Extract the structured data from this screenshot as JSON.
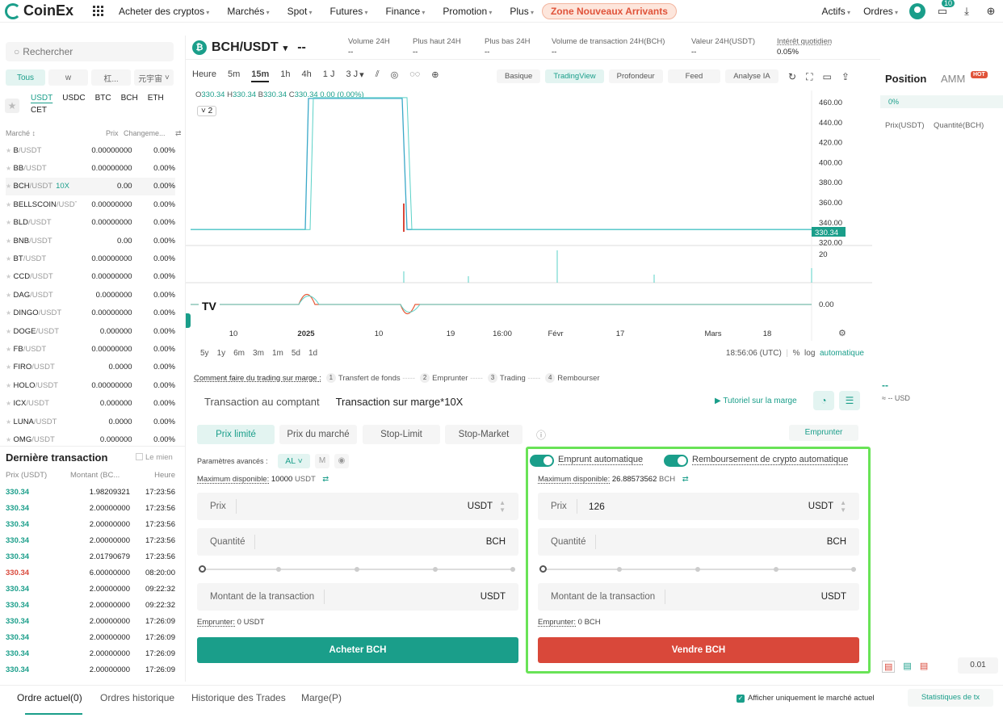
{
  "nav": {
    "logo": "CoinEx",
    "items": [
      "Acheter des cryptos",
      "Marchés",
      "Spot",
      "Futures",
      "Finance",
      "Promotion",
      "Plus"
    ],
    "zone": "Zone Nouveaux Arrivants",
    "right": [
      "Actifs",
      "Ordres"
    ],
    "notif_count": "10"
  },
  "market": {
    "search_placeholder": "Rechercher",
    "filter_tabs": [
      "Tous",
      "w",
      "杠...",
      "元宇宙"
    ],
    "quote_tabs": [
      "USDT",
      "USDC",
      "BTC",
      "BCH",
      "ETH",
      "CET"
    ],
    "head_market": "Marché",
    "head_price": "Prix",
    "head_change": "Changeme...",
    "rows": [
      {
        "base": "B",
        "quote": "/USDT",
        "lev": "",
        "price": "0.00000000",
        "chg": "0.00%"
      },
      {
        "base": "BB",
        "quote": "/USDT",
        "lev": "",
        "price": "0.00000000",
        "chg": "0.00%"
      },
      {
        "base": "BCH",
        "quote": "/USDT",
        "lev": "10X",
        "price": "0.00",
        "chg": "0.00%"
      },
      {
        "base": "BELLSCOIN",
        "quote": "/USDT",
        "lev": "",
        "price": "0.00000000",
        "chg": "0.00%"
      },
      {
        "base": "BLD",
        "quote": "/USDT",
        "lev": "",
        "price": "0.00000000",
        "chg": "0.00%"
      },
      {
        "base": "BNB",
        "quote": "/USDT",
        "lev": "",
        "price": "0.00",
        "chg": "0.00%"
      },
      {
        "base": "BT",
        "quote": "/USDT",
        "lev": "",
        "price": "0.00000000",
        "chg": "0.00%"
      },
      {
        "base": "CCD",
        "quote": "/USDT",
        "lev": "",
        "price": "0.00000000",
        "chg": "0.00%"
      },
      {
        "base": "DAG",
        "quote": "/USDT",
        "lev": "",
        "price": "0.0000000",
        "chg": "0.00%"
      },
      {
        "base": "DINGO",
        "quote": "/USDT",
        "lev": "",
        "price": "0.00000000",
        "chg": "0.00%"
      },
      {
        "base": "DOGE",
        "quote": "/USDT",
        "lev": "",
        "price": "0.000000",
        "chg": "0.00%"
      },
      {
        "base": "FB",
        "quote": "/USDT",
        "lev": "",
        "price": "0.00000000",
        "chg": "0.00%"
      },
      {
        "base": "FIRO",
        "quote": "/USDT",
        "lev": "",
        "price": "0.0000",
        "chg": "0.00%"
      },
      {
        "base": "HOLO",
        "quote": "/USDT",
        "lev": "",
        "price": "0.00000000",
        "chg": "0.00%"
      },
      {
        "base": "ICX",
        "quote": "/USDT",
        "lev": "",
        "price": "0.000000",
        "chg": "0.00%"
      },
      {
        "base": "LUNA",
        "quote": "/USDT",
        "lev": "",
        "price": "0.0000",
        "chg": "0.00%"
      },
      {
        "base": "OMG",
        "quote": "/USDT",
        "lev": "",
        "price": "0.000000",
        "chg": "0.00%"
      }
    ]
  },
  "trades": {
    "title": "Dernière transaction",
    "mine": "Le mien",
    "head_price": "Prix (USDT)",
    "head_amount": "Montant (BC...",
    "head_time": "Heure",
    "rows": [
      {
        "price": "330.34",
        "amount": "1.98209321",
        "time": "17:23:56",
        "side": "up"
      },
      {
        "price": "330.34",
        "amount": "2.00000000",
        "time": "17:23:56",
        "side": "up"
      },
      {
        "price": "330.34",
        "amount": "2.00000000",
        "time": "17:23:56",
        "side": "up"
      },
      {
        "price": "330.34",
        "amount": "2.00000000",
        "time": "17:23:56",
        "side": "up"
      },
      {
        "price": "330.34",
        "amount": "2.01790679",
        "time": "17:23:56",
        "side": "up"
      },
      {
        "price": "330.34",
        "amount": "6.00000000",
        "time": "08:20:00",
        "side": "down"
      },
      {
        "price": "330.34",
        "amount": "2.00000000",
        "time": "09:22:32",
        "side": "up"
      },
      {
        "price": "330.34",
        "amount": "2.00000000",
        "time": "09:22:32",
        "side": "up"
      },
      {
        "price": "330.34",
        "amount": "2.00000000",
        "time": "17:26:09",
        "side": "up"
      },
      {
        "price": "330.34",
        "amount": "2.00000000",
        "time": "17:26:09",
        "side": "up"
      },
      {
        "price": "330.34",
        "amount": "2.00000000",
        "time": "17:26:09",
        "side": "up"
      },
      {
        "price": "330.34",
        "amount": "2.00000000",
        "time": "17:26:09",
        "side": "up"
      }
    ]
  },
  "ticker": {
    "pair": "BCH/USDT",
    "last": "--",
    "stats": [
      {
        "label": "Volume 24H",
        "value": "--"
      },
      {
        "label": "Plus haut 24H",
        "value": "--"
      },
      {
        "label": "Plus bas 24H",
        "value": "--"
      },
      {
        "label": "Volume de transaction 24H(BCH)",
        "value": "--"
      },
      {
        "label": "Valeur 24H(USDT)",
        "value": "--"
      },
      {
        "label": "Intérêt quotidien",
        "value": "0.05%"
      }
    ]
  },
  "chart": {
    "intervals": [
      "Heure",
      "5m",
      "15m",
      "1h",
      "4h",
      "1 J",
      "3 J"
    ],
    "active_interval": "15m",
    "views": [
      "Basique",
      "TradingView",
      "Profondeur",
      "Feed",
      "Analyse IA"
    ],
    "active_view": "TradingView",
    "ohlc": {
      "o": "330.34",
      "h": "330.34",
      "l": "330.34",
      "c": "330.34",
      "chg": "0.00 (0.00%)"
    },
    "series_count": "2",
    "price_ticks": [
      "460.00",
      "440.00",
      "420.00",
      "400.00",
      "380.00",
      "360.00",
      "340.00",
      "320.00"
    ],
    "last_price_tag": "330.34",
    "volume_tick": "20",
    "osc_tick": "0.00",
    "x_ticks": [
      "10",
      "2025",
      "10",
      "19",
      "16:00",
      "Févr",
      "17",
      "Mars",
      "18"
    ],
    "ranges": [
      "5y",
      "1y",
      "6m",
      "3m",
      "1m",
      "5d",
      "1d"
    ],
    "clock": "18:56:06 (UTC)",
    "scale_opts": [
      "%",
      "log",
      "automatique"
    ]
  },
  "chart_data": {
    "type": "line",
    "title": "",
    "ylabel": "",
    "ylim": [
      320,
      470
    ],
    "series": [
      {
        "name": "",
        "values": [
          330.34,
          330.34,
          330.34,
          462,
          462,
          462,
          462,
          330.34,
          330.34,
          330.34,
          330.34,
          330.34
        ]
      }
    ]
  },
  "steps": {
    "title": "Comment faire du trading sur marge :",
    "items": [
      "Transfert de fonds",
      "Emprunter",
      "Trading",
      "Rembourser"
    ]
  },
  "order": {
    "tabs": [
      "Transaction au comptant",
      "Transaction sur marge*10X"
    ],
    "tutorial": "Tutoriel sur la marge",
    "types": [
      "Prix limité",
      "Prix du marché",
      "Stop-Limit",
      "Stop-Market"
    ],
    "borrow_btn": "Emprunter",
    "adv_label": "Paramètres avancés :",
    "adv_value": "AL",
    "adv_m": "M",
    "buy": {
      "max_label": "Maximum disponible:",
      "max_value": "10000",
      "max_unit": "USDT",
      "price_label": "Prix",
      "price_value": "",
      "price_unit": "USDT",
      "qty_label": "Quantité",
      "qty_unit": "BCH",
      "amount_label": "Montant de la transaction",
      "amount_unit": "USDT",
      "borrow_label": "Emprunter:",
      "borrow_value": "0 USDT",
      "button": "Acheter BCH"
    },
    "sell": {
      "auto_borrow": "Emprunt automatique",
      "auto_repay": "Remboursement de crypto automatique",
      "max_label": "Maximum disponible:",
      "max_value": "26.88573562",
      "max_unit": "BCH",
      "price_label": "Prix",
      "price_value": "126",
      "price_unit": "USDT",
      "qty_label": "Quantité",
      "qty_unit": "BCH",
      "amount_label": "Montant de la transaction",
      "amount_unit": "USDT",
      "borrow_label": "Emprunter:",
      "borrow_value": "0 BCH",
      "button": "Vendre BCH"
    }
  },
  "position": {
    "tab_position": "Position",
    "tab_amm": "AMM",
    "hot": "HOT",
    "pct": "0%",
    "head_price": "Prix(USDT)",
    "head_qty": "Quantité(BCH)",
    "dash": "--",
    "usd": "≈ -- USD",
    "step": "0.01"
  },
  "bottom": {
    "tabs": [
      "Ordre actuel(0)",
      "Ordres historique",
      "Historique des Trades",
      "Marge(P)"
    ],
    "only_current": "Afficher uniquement le marché actuel",
    "stats_btn": "Statistiques de tx"
  },
  "colors": {
    "accent": "#1a9e8a",
    "sell": "#d9483a",
    "highlight": "#69e357"
  }
}
